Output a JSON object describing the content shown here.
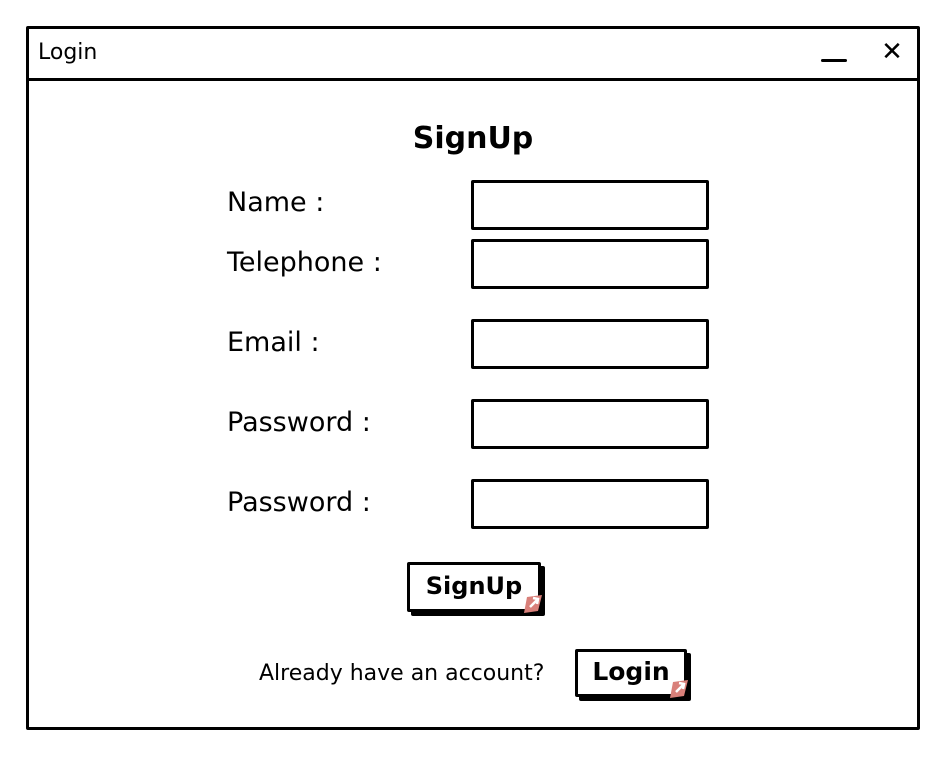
{
  "window": {
    "title": "Login",
    "close_glyph": "✕"
  },
  "form": {
    "heading": "SignUp",
    "fields": [
      {
        "label": "Name :",
        "value": ""
      },
      {
        "label": "Telephone :",
        "value": ""
      },
      {
        "label": "Email :",
        "value": ""
      },
      {
        "label": "Password :",
        "value": ""
      },
      {
        "label": "Password :",
        "value": ""
      }
    ],
    "submit_label": "SignUp"
  },
  "footer": {
    "prompt": "Already have an account?",
    "login_label": "Login"
  },
  "icons": {
    "minimize": "minimize-icon",
    "close": "close-icon",
    "cursor": "hand-cursor-icon"
  },
  "colors": {
    "cursor_accent": "#d9807a",
    "stroke": "#000000",
    "background": "#ffffff"
  }
}
